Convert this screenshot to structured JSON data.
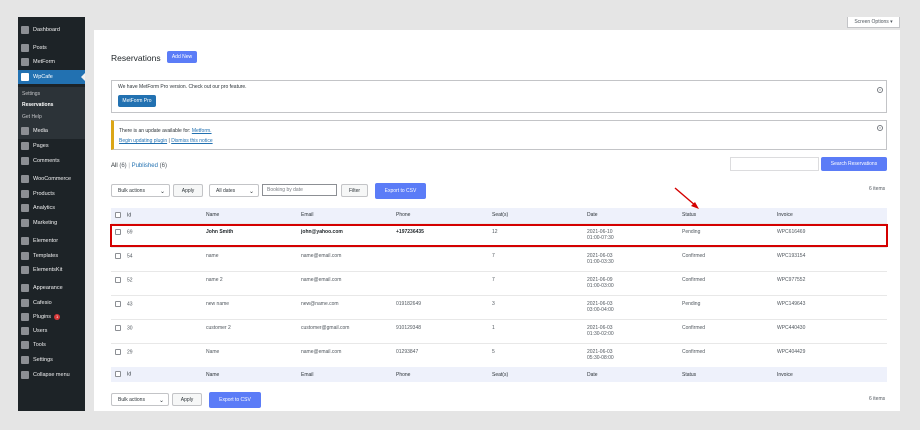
{
  "sidebar": {
    "items": [
      {
        "label": "Dashboard",
        "icon": "dashboard-icon"
      },
      {
        "label": "Posts",
        "icon": "pin-icon"
      },
      {
        "label": "MetForm",
        "icon": "form-icon"
      },
      {
        "label": "WpCafe",
        "icon": "cafe-icon"
      },
      {
        "label": "Media",
        "icon": "media-icon"
      },
      {
        "label": "Pages",
        "icon": "page-icon"
      },
      {
        "label": "Comments",
        "icon": "comment-icon"
      },
      {
        "label": "WooCommerce",
        "icon": "woocommerce-icon"
      },
      {
        "label": "Products",
        "icon": "products-icon"
      },
      {
        "label": "Analytics",
        "icon": "analytics-icon"
      },
      {
        "label": "Marketing",
        "icon": "megaphone-icon"
      },
      {
        "label": "Elementor",
        "icon": "elementor-icon"
      },
      {
        "label": "Templates",
        "icon": "templates-icon"
      },
      {
        "label": "ElementsKit",
        "icon": "elementskit-icon"
      },
      {
        "label": "Appearance",
        "icon": "brush-icon"
      },
      {
        "label": "Cafesio",
        "icon": "cafesio-icon"
      },
      {
        "label": "Plugins",
        "icon": "plugin-icon",
        "badge": "1"
      },
      {
        "label": "Users",
        "icon": "user-icon"
      },
      {
        "label": "Tools",
        "icon": "wrench-icon"
      },
      {
        "label": "Settings",
        "icon": "settings-icon"
      },
      {
        "label": "Collapse menu",
        "icon": "collapse-icon"
      }
    ],
    "submenu": [
      "Settings",
      "Reservations",
      "Get Help"
    ]
  },
  "screen_options": "Screen Options ▾",
  "page": {
    "title": "Reservations",
    "add_new": "Add New"
  },
  "notice1": {
    "text": "We have MetForm Pro version. Check out our pro feature.",
    "button": "MetForm Pro"
  },
  "notice2": {
    "text": "There is an update available for:",
    "plugin": "Metform.",
    "begin": "Begin updating plugin",
    "sep": "|",
    "dismiss": "Dismiss this notice"
  },
  "filters": {
    "all": "All",
    "all_count": "(6)",
    "sep": "|",
    "published": "Published",
    "published_count": "(6)"
  },
  "search_button": "Search Reservations",
  "items_count": "6 items",
  "toolbar": {
    "bulk": "Bulk actions",
    "apply": "Apply",
    "dates": "All dates",
    "booking_placeholder": "Booking by date",
    "filter": "Filter",
    "export": "Export to CSV"
  },
  "columns": [
    "Id",
    "Name",
    "Email",
    "Phone",
    "Seat(s)",
    "Date",
    "Status",
    "Invoice"
  ],
  "rows": [
    {
      "id": "69",
      "name": "John Smith",
      "email": "john@yahoo.com",
      "phone": "+197236435",
      "seats": "12",
      "date": "2021-06-10",
      "time": "01:00-07:30",
      "status": "Pending",
      "invoice": "WPC616469"
    },
    {
      "id": "54",
      "name": "name",
      "email": "name@email.com",
      "phone": "",
      "seats": "7",
      "date": "2021-06-03",
      "time": "01:00-03:30",
      "status": "Confirmed",
      "invoice": "WPC193154"
    },
    {
      "id": "52",
      "name": "name 2",
      "email": "name@email.com",
      "phone": "",
      "seats": "7",
      "date": "2021-06-09",
      "time": "01:00-03:00",
      "status": "Confirmed",
      "invoice": "WPC977552"
    },
    {
      "id": "43",
      "name": "new name",
      "email": "new@name.com",
      "phone": "019182649",
      "seats": "3",
      "date": "2021-06-03",
      "time": "03:00-04:00",
      "status": "Pending",
      "invoice": "WPC149643"
    },
    {
      "id": "30",
      "name": "customer 2",
      "email": "customer@gmail.com",
      "phone": "910129348",
      "seats": "1",
      "date": "2021-06-03",
      "time": "01:30-02:00",
      "status": "Confirmed",
      "invoice": "WPC440430"
    },
    {
      "id": "29",
      "name": "Name",
      "email": "name@email.com",
      "phone": "01293847",
      "seats": "5",
      "date": "2021-06-03",
      "time": "05:30-08:00",
      "status": "Confirmed",
      "invoice": "WPC404429"
    }
  ],
  "colors": {
    "sidebar": "#1d2327",
    "accent": "#2271b1",
    "button": "#5b7cf7",
    "highlight": "#d40000"
  }
}
